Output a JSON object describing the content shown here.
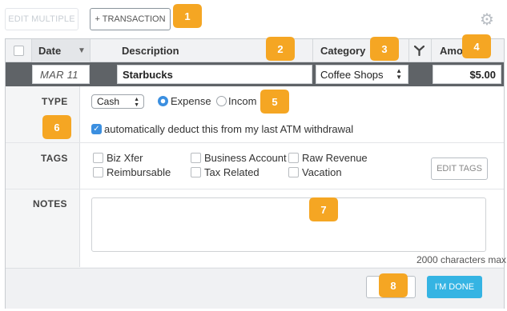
{
  "toolbar": {
    "edit_multiple_label": "EDIT MULTIPLE",
    "add_transaction_label": "+ TRANSACTION",
    "settings_icon": "gear-icon"
  },
  "columns": {
    "date": "Date",
    "description": "Description",
    "category": "Category",
    "amount": "Amo"
  },
  "edit_row": {
    "date": "MAR 11",
    "description": "Starbucks",
    "category": "Coffee Shops",
    "amount": "$5.00"
  },
  "type": {
    "label": "TYPE",
    "method": "Cash",
    "expense_label": "Expense",
    "income_label": "Incom",
    "selected": "Expense",
    "auto_deduct_label": "automatically deduct this from my last ATM withdrawal",
    "auto_deduct_checked": true
  },
  "tags": {
    "label": "TAGS",
    "items": [
      "Biz Xfer",
      "Business Account",
      "Raw Revenue",
      "Reimbursable",
      "Tax Related",
      "Vacation"
    ],
    "edit_label": "EDIT TAGS"
  },
  "notes": {
    "label": "NOTES",
    "value": "",
    "chars_max": "2000 characters max"
  },
  "footer": {
    "cancel_label": "CA",
    "done_label": "I'M DONE"
  },
  "callouts": [
    "1",
    "2",
    "3",
    "4",
    "5",
    "6",
    "7",
    "8"
  ],
  "colors": {
    "callout": "#f5a623",
    "accent": "#3b8fe0",
    "done_button": "#35b4e3",
    "edit_row": "#5f6367"
  }
}
